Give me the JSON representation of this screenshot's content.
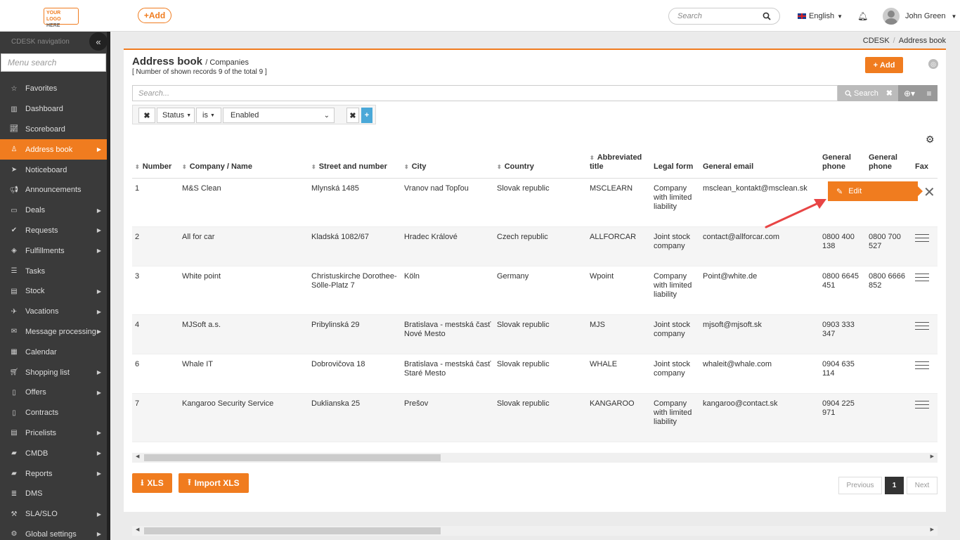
{
  "header": {
    "logo_line1": "YOUR LOGO",
    "logo_line2": "HERE",
    "add_label": "+Add",
    "search_placeholder": "Search",
    "language": "English",
    "user_name": "John Green"
  },
  "sidebar": {
    "title": "CDESK navigation",
    "menu_search_placeholder": "Menu search",
    "items": [
      {
        "label": "Favorites",
        "icon": "star-icon",
        "submenu": false
      },
      {
        "label": "Dashboard",
        "icon": "bar-chart-icon",
        "submenu": false
      },
      {
        "label": "Scoreboard",
        "icon": "line-chart-icon",
        "submenu": false
      },
      {
        "label": "Address book",
        "icon": "user-icon",
        "submenu": true,
        "active": true
      },
      {
        "label": "Noticeboard",
        "icon": "paper-plane-icon",
        "submenu": false
      },
      {
        "label": "Announcements",
        "icon": "bullhorn-icon",
        "submenu": false
      },
      {
        "label": "Deals",
        "icon": "credit-card-icon",
        "submenu": true
      },
      {
        "label": "Requests",
        "icon": "check-circle-icon",
        "submenu": true
      },
      {
        "label": "Fulfillments",
        "icon": "cube-icon",
        "submenu": true
      },
      {
        "label": "Tasks",
        "icon": "tasks-icon",
        "submenu": false
      },
      {
        "label": "Stock",
        "icon": "archive-icon",
        "submenu": true
      },
      {
        "label": "Vacations",
        "icon": "plane-icon",
        "submenu": true
      },
      {
        "label": "Message processing",
        "icon": "envelope-icon",
        "submenu": true
      },
      {
        "label": "Calendar",
        "icon": "calendar-icon",
        "submenu": false
      },
      {
        "label": "Shopping list",
        "icon": "cart-icon",
        "submenu": true
      },
      {
        "label": "Offers",
        "icon": "file-icon",
        "submenu": true
      },
      {
        "label": "Contracts",
        "icon": "document-icon",
        "submenu": false
      },
      {
        "label": "Pricelists",
        "icon": "file-text-icon",
        "submenu": true
      },
      {
        "label": "CMDB",
        "icon": "folder-icon",
        "submenu": true
      },
      {
        "label": "Reports",
        "icon": "folder-open-icon",
        "submenu": true
      },
      {
        "label": "DMS",
        "icon": "database-icon",
        "submenu": false
      },
      {
        "label": "SLA/SLO",
        "icon": "gavel-icon",
        "submenu": true
      },
      {
        "label": "Global settings",
        "icon": "cogs-icon",
        "submenu": true
      }
    ]
  },
  "breadcrumb": {
    "root": "CDESK",
    "current": "Address book"
  },
  "page": {
    "title": "Address book",
    "subtitle": "/ Companies",
    "records_info": "[ Number of shown records 9 of the total 9 ]",
    "add_label": "Add",
    "search_placeholder": "Search...",
    "search_button": "Search"
  },
  "filter": {
    "field": "Status",
    "operator": "is",
    "value": "Enabled"
  },
  "table": {
    "headers": [
      "Number",
      "Company / Name",
      "Street and number",
      "City",
      "Country",
      "Abbreviated title",
      "Legal form",
      "General email",
      "General phone",
      "General phone",
      "Fax"
    ],
    "rows": [
      {
        "number": "1",
        "company": "M&S Clean",
        "street": "Mlynská 1485",
        "city": "Vranov nad Topľou",
        "country": "Slovak republic",
        "abbr": "MSCLEARN",
        "legal": "Company with limited liability",
        "email": "msclean_kontakt@msclean.sk",
        "phone1": "",
        "phone2": "",
        "fax": ""
      },
      {
        "number": "2",
        "company": "All for car",
        "street": "Kladská 1082/67",
        "city": "Hradec Králové",
        "country": "Czech republic",
        "abbr": "ALLFORCAR",
        "legal": "Joint stock company",
        "email": "contact@allforcar.com",
        "phone1": "0800 400 138",
        "phone2": "0800 700 527",
        "fax": ""
      },
      {
        "number": "3",
        "company": "White point",
        "street": "Christuskirche Dorothee-Sölle-Platz 7",
        "city": " Köln",
        "country": "Germany",
        "abbr": "Wpoint",
        "legal": "Company with limited liability",
        "email": "Point@white.de",
        "phone1": "0800 6645 451",
        "phone2": "0800 6666 852",
        "fax": ""
      },
      {
        "number": "4",
        "company": "MJSoft a.s.",
        "street": "Pribylinská 29",
        "city": "Bratislava - mestská časť Nové Mesto",
        "country": "Slovak republic",
        "abbr": "MJS",
        "legal": "Joint stock company",
        "email": "mjsoft@mjsoft.sk",
        "phone1": "0903 333 347",
        "phone2": "",
        "fax": ""
      },
      {
        "number": "6",
        "company": "Whale IT",
        "street": "Dobrovičova 18",
        "city": "Bratislava - mestská časť Staré Mesto",
        "country": "Slovak republic",
        "abbr": "WHALE",
        "legal": "Joint stock company",
        "email": "whaleit@whale.com",
        "phone1": "0904 635 114",
        "phone2": "",
        "fax": ""
      },
      {
        "number": "7",
        "company": "Kangaroo Security Service",
        "street": "Duklianska 25",
        "city": "Prešov",
        "country": "Slovak republic",
        "abbr": "KANGAROO",
        "legal": "Company with limited liability",
        "email": "kangaroo@contact.sk",
        "phone1": "0904 225 971",
        "phone2": "",
        "fax": ""
      }
    ]
  },
  "row_action": {
    "edit_label": "Edit"
  },
  "footer": {
    "xls_label": "XLS",
    "import_label": "Import XLS",
    "previous_label": "Previous",
    "page": "1",
    "next_label": "Next"
  },
  "colors": {
    "accent": "#f07c1f",
    "sidebar_bg": "#3a3a3a"
  }
}
